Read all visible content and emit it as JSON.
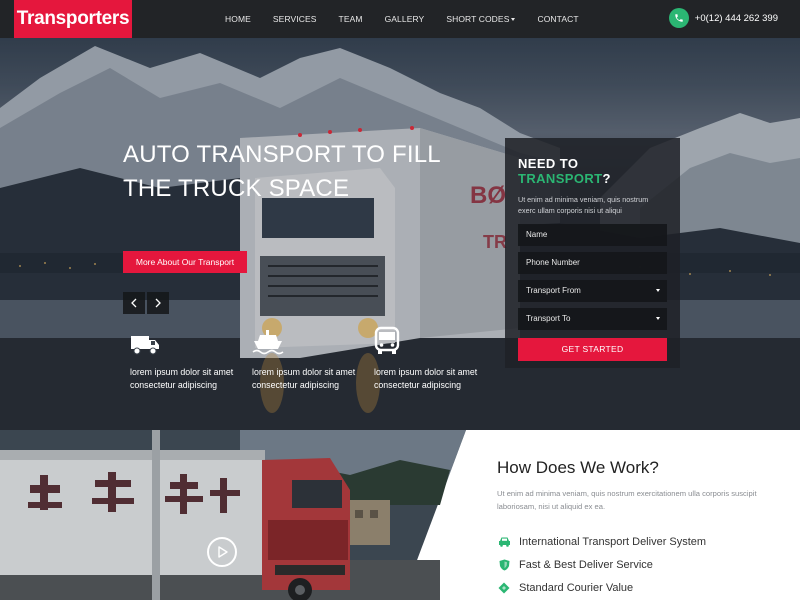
{
  "brand": {
    "logo": "Transporters",
    "accent": "#e5173d",
    "green": "#2bb673"
  },
  "nav": {
    "items": [
      "HOME",
      "SERVICES",
      "TEAM",
      "GALLERY",
      "SHORT CODES",
      "CONTACT"
    ],
    "phone": "+0(12) 444 262 399",
    "phone_icon": "phone-icon"
  },
  "hero": {
    "title_line1": "AUTO TRANSPORT TO FILL",
    "title_line2": "THE TRUCK SPACE",
    "button": "More About Our Transport",
    "features": [
      {
        "icon": "truck-icon",
        "text": "lorem ipsum dolor sit amet consectetur adipiscing"
      },
      {
        "icon": "ship-icon",
        "text": "lorem ipsum dolor sit amet consectetur adipiscing"
      },
      {
        "icon": "bus-icon",
        "text": "lorem ipsum dolor sit amet consectetur adipiscing"
      }
    ]
  },
  "form": {
    "title_prefix": "NEED TO ",
    "title_accent": "TRANSPORT",
    "title_suffix": "?",
    "description": "Ut enim ad minima veniam, quis nostrum exerc ullam corporis nisi ut aliqui",
    "name_placeholder": "Name",
    "phone_placeholder": "Phone Number",
    "from_select": "Transport From",
    "to_select": "Transport To",
    "submit": "GET STARTED"
  },
  "how": {
    "title": "How Does We Work?",
    "description": "Ut enim ad minima veniam, quis nostrum exercitationem ulla corporis suscipit laboriosam, nisi ut aliquid ex ea.",
    "items": [
      {
        "icon": "car-icon",
        "text": "International Transport Deliver System"
      },
      {
        "icon": "shield-icon",
        "text": "Fast & Best Deliver Service"
      },
      {
        "icon": "tag-icon",
        "text": "Standard Courier Value"
      }
    ]
  }
}
